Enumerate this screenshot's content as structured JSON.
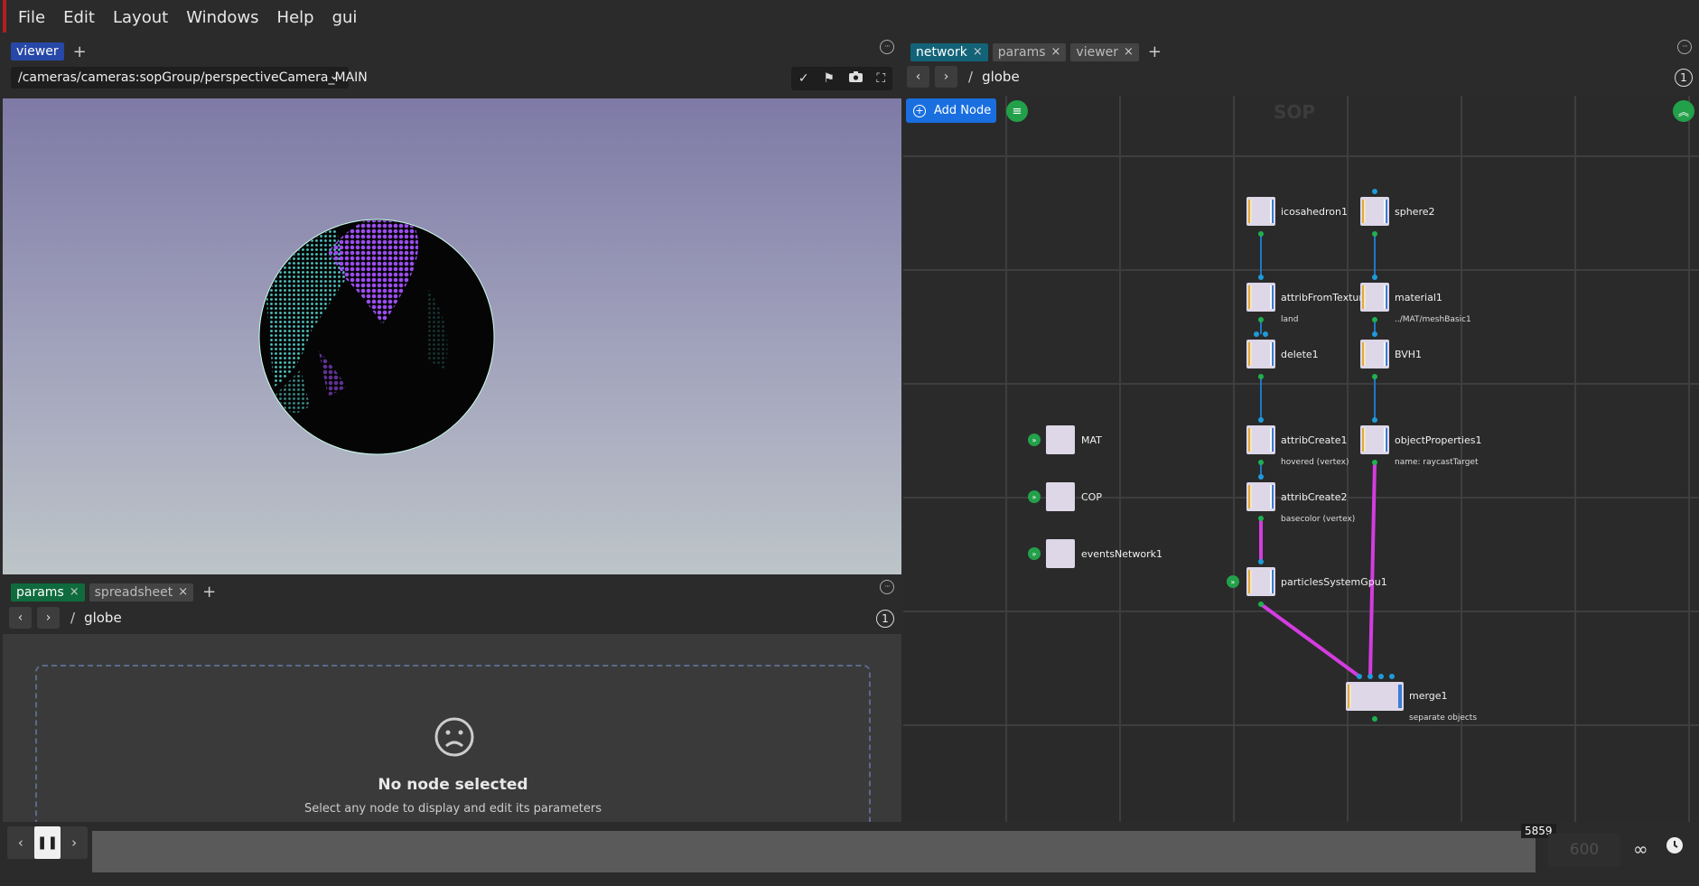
{
  "menu": [
    "File",
    "Edit",
    "Layout",
    "Windows",
    "Help",
    "gui"
  ],
  "viewer": {
    "tab": "viewer",
    "camera_path": "/cameras/cameras:sopGroup/perspectiveCamera_MAIN",
    "tools": [
      "check-icon",
      "flag-icon",
      "camera-icon",
      "fullscreen-icon"
    ]
  },
  "params": {
    "tabs": [
      "params",
      "spreadsheet"
    ],
    "path_sep": "/",
    "path": "globe",
    "empty_title": "No node selected",
    "empty_sub": "Select any node to display and edit its parameters"
  },
  "network": {
    "tabs": [
      "network",
      "params",
      "viewer"
    ],
    "path_sep": "/",
    "path": "globe",
    "add_node_label": "Add Node",
    "context_label": "SOP",
    "nodes": {
      "icosahedron1": "icosahedron1",
      "sphere2": "sphere2",
      "attribFromTexture1": "attribFromTexture1",
      "attribFromTexture1_sub": "land",
      "material1": "material1",
      "material1_sub": "../MAT/meshBasic1",
      "delete1": "delete1",
      "BVH1": "BVH1",
      "MAT": "MAT",
      "attribCreate1": "attribCreate1",
      "attribCreate1_sub": "hovered (vertex)",
      "objectProperties1": "objectProperties1",
      "objectProperties1_sub": "name: raycastTarget",
      "COP": "COP",
      "attribCreate2": "attribCreate2",
      "attribCreate2_sub": "basecolor (vertex)",
      "eventsNetwork1": "eventsNetwork1",
      "particlesSystemGpu1": "particlesSystemGpu1",
      "merge1": "merge1",
      "merge1_sub": "separate objects"
    }
  },
  "timeline": {
    "current_frame": "5859",
    "end_frame": "600"
  },
  "colors": {
    "menu_accent": "#b41e1e",
    "add_node": "#1a6fe0",
    "badge_green": "#23a04a",
    "wire_blue": "#1f78c8",
    "wire_magenta": "#d43ce0"
  }
}
